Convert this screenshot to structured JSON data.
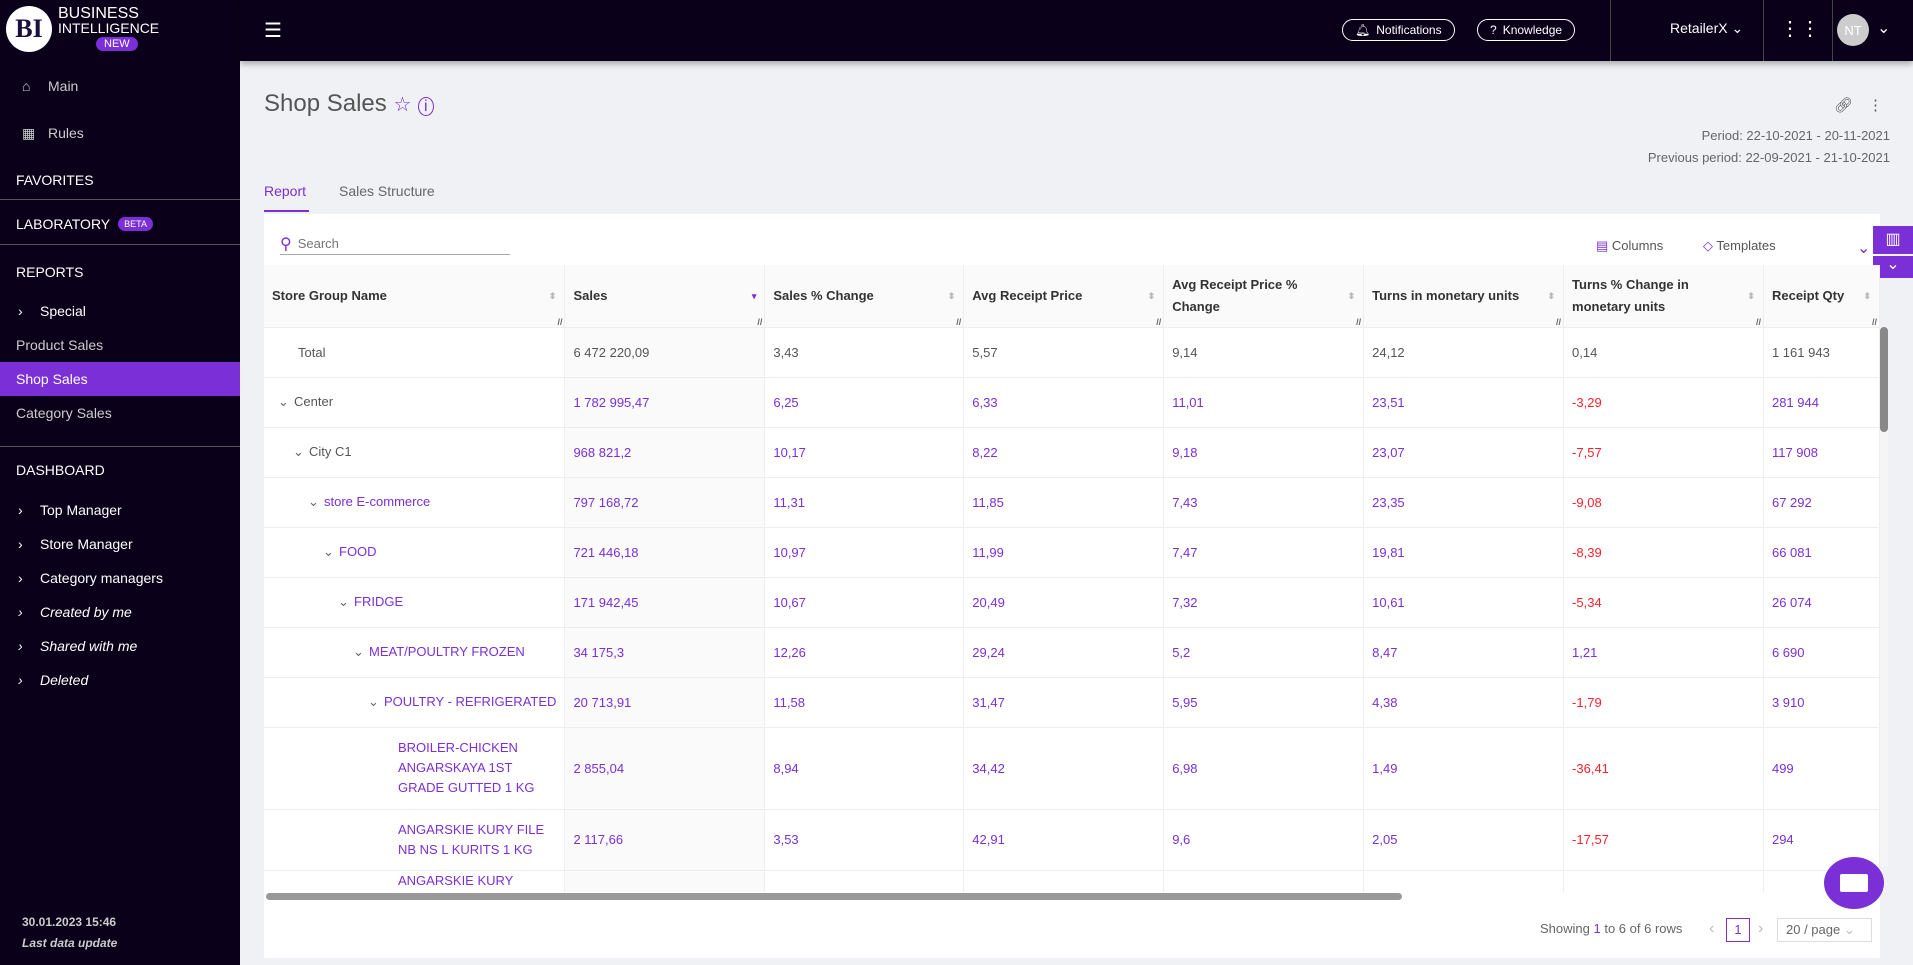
{
  "brand": {
    "logo": "BI",
    "line1": "BUSINESS",
    "line2": "INTELLIGENCE",
    "badge": "NEW"
  },
  "sidebar": {
    "main": "Main",
    "rules": "Rules",
    "favorites": "FAVORITES",
    "laboratory": "LABORATORY",
    "beta": "BETA",
    "reports": "REPORTS",
    "special": "Special",
    "product_sales": "Product Sales",
    "shop_sales": "Shop Sales",
    "category_sales": "Category Sales",
    "dashboard": "DASHBOARD",
    "dash_items": [
      "Top Manager",
      "Store Manager",
      "Category managers",
      "Created by me",
      "Shared with me",
      "Deleted"
    ],
    "update_time": "30.01.2023 15:46",
    "update_label": "Last data update"
  },
  "topbar": {
    "notifications": "Notifications",
    "knowledge": "Knowledge",
    "retailer": "RetailerX",
    "avatar": "NT"
  },
  "page": {
    "title": "Shop Sales",
    "period": "Period: 22-10-2021 - 20-11-2021",
    "previous_period": "Previous period: 22-09-2021 - 21-10-2021",
    "tabs": [
      "Report",
      "Sales Structure"
    ],
    "active_tab": "Report"
  },
  "toolbar": {
    "search_placeholder": "Search",
    "columns": "Columns",
    "templates": "Templates"
  },
  "colors": {
    "accent": "#7b2fd6",
    "negative": "#f5222d",
    "sidebar_bg": "#0a0019"
  },
  "table": {
    "columns": [
      "Store Group Name",
      "Sales",
      "Sales % Change",
      "Avg Receipt Price",
      "Avg Receipt Price % Change",
      "Turns in monetary units",
      "Turns % Change in monetary units",
      "Receipt Qty"
    ],
    "sorted_column": "Sales",
    "rows": [
      {
        "name": "Total",
        "level": 0,
        "expanded": null,
        "values": [
          "6 472 220,09",
          "3,43",
          "5,57",
          "9,14",
          "24,12",
          "0,14",
          "1 161 943"
        ]
      },
      {
        "name": "Center",
        "level": 0,
        "expanded": true,
        "values": [
          "1 782 995,47",
          "6,25",
          "6,33",
          "11,01",
          "23,51",
          "-3,29",
          "281 944"
        ]
      },
      {
        "name": "City C1",
        "level": 1,
        "expanded": true,
        "values": [
          "968 821,2",
          "10,17",
          "8,22",
          "9,18",
          "23,07",
          "-7,57",
          "117 908"
        ]
      },
      {
        "name": "store E-commerce",
        "level": 2,
        "expanded": true,
        "values": [
          "797 168,72",
          "11,31",
          "11,85",
          "7,43",
          "23,35",
          "-9,08",
          "67 292"
        ]
      },
      {
        "name": "FOOD",
        "level": 3,
        "expanded": true,
        "values": [
          "721 446,18",
          "10,97",
          "11,99",
          "7,47",
          "19,81",
          "-8,39",
          "66 081"
        ]
      },
      {
        "name": "FRIDGE",
        "level": 4,
        "expanded": true,
        "values": [
          "171 942,45",
          "10,67",
          "20,49",
          "7,32",
          "10,61",
          "-5,34",
          "26 074"
        ]
      },
      {
        "name": "MEAT/POULTRY FROZEN",
        "level": 5,
        "expanded": true,
        "values": [
          "34 175,3",
          "12,26",
          "29,24",
          "5,2",
          "8,47",
          "1,21",
          "6 690"
        ]
      },
      {
        "name": "POULTRY - REFRIGERATED",
        "level": 6,
        "expanded": true,
        "values": [
          "20 713,91",
          "11,58",
          "31,47",
          "5,95",
          "4,38",
          "-1,79",
          "3 910"
        ]
      },
      {
        "name": "BROILER-CHICKEN ANGARSKAYA 1ST GRADE GUTTED 1 KG",
        "level": 7,
        "expanded": null,
        "values": [
          "2 855,04",
          "8,94",
          "34,42",
          "6,98",
          "1,49",
          "-36,41",
          "499"
        ]
      },
      {
        "name": "ANGARSKIE KURY FILE NB NS L KURITS 1 KG",
        "level": 7,
        "expanded": null,
        "values": [
          "2 117,66",
          "3,53",
          "42,91",
          "9,6",
          "2,05",
          "-17,57",
          "294"
        ]
      },
      {
        "name": "ANGARSKIE KURY",
        "level": 7,
        "expanded": null,
        "values": [
          "",
          "",
          "",
          "",
          "",
          "",
          ""
        ]
      }
    ]
  },
  "pagination": {
    "summary_prefix": "Showing ",
    "from": "1",
    "to_word": " to ",
    "to": "6",
    "of_word": " of ",
    "total": "6",
    "suffix": " rows",
    "page": "1",
    "page_size": "20 / page"
  }
}
